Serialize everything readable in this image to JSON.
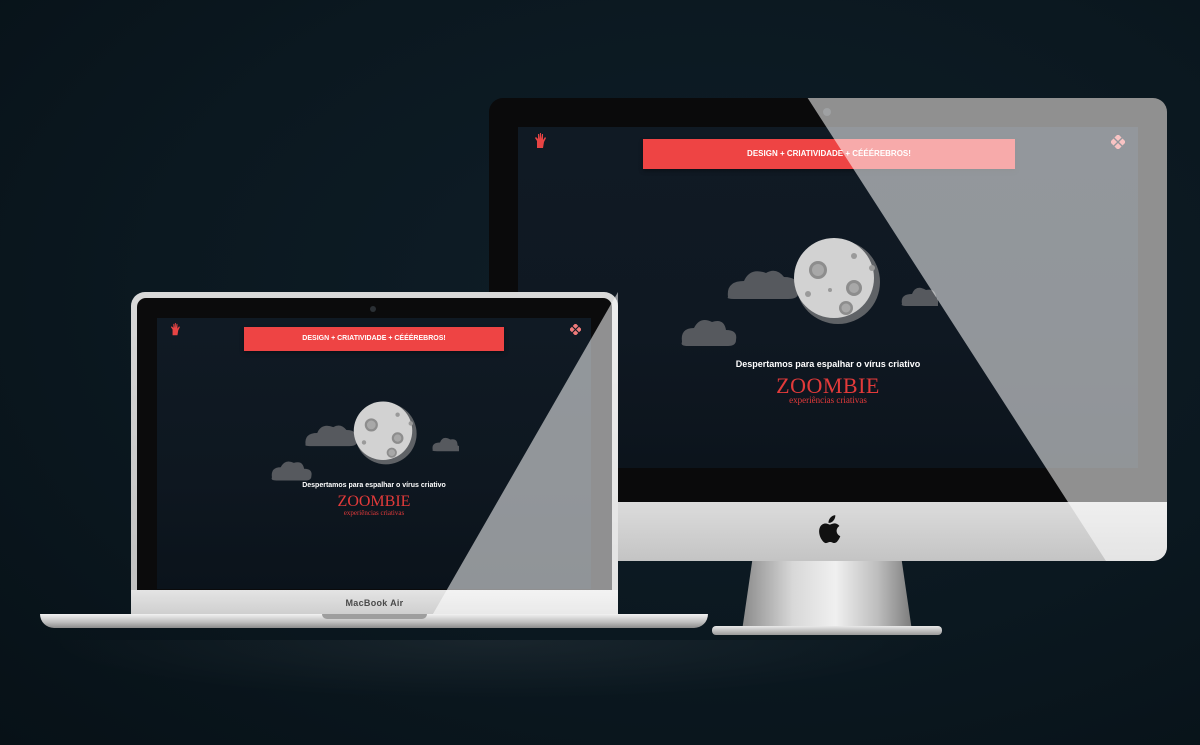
{
  "site": {
    "banner_text": "DESIGN + CRIATIVIDADE + CÉÉÉREBROS!",
    "tagline": "Despertamos para espalhar o vírus criativo",
    "brand_name": "ZOOMBIE",
    "brand_subtitle": "experiências criativas",
    "left_icon": "zombie-hand-icon",
    "right_icon": "diamond-flower-icon",
    "scene_icons": [
      "moon-icon",
      "cloud-icon"
    ]
  },
  "devices": {
    "laptop_label": "MacBook Air",
    "desktop_logo_icon": "apple-logo-icon"
  },
  "colors": {
    "background": "#0b1820",
    "screen_bg": "#101a24",
    "accent_red": "#ee4444",
    "brand_red": "#e23a3a",
    "moon_gray": "#cfcfcf",
    "cloud_gray": "#56595e"
  }
}
